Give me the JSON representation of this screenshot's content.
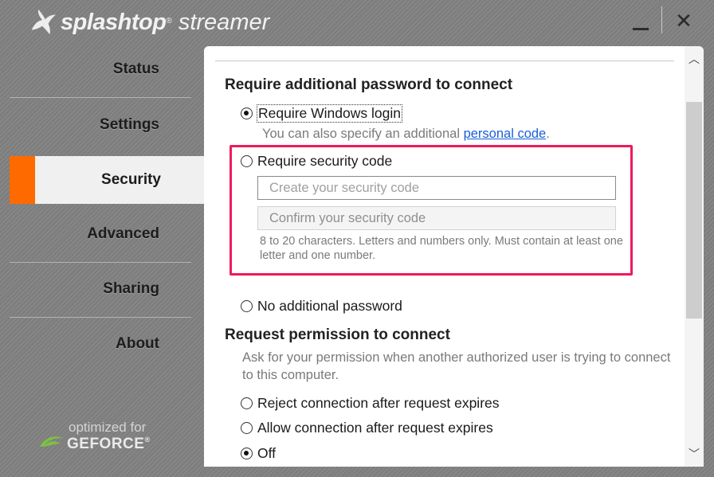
{
  "app": {
    "logo_part1": "splashtop",
    "logo_tm": "®",
    "logo_part2": "streamer",
    "logo_icon": "splashtop-bird-icon",
    "minimize_icon": "minimize-icon",
    "close_icon": "close-icon",
    "close_glyph": "✕"
  },
  "sidebar": {
    "items": [
      {
        "label": "Status"
      },
      {
        "label": "Settings"
      },
      {
        "label": "Security",
        "active": true
      },
      {
        "label": "Advanced"
      },
      {
        "label": "Sharing"
      },
      {
        "label": "About"
      }
    ],
    "accent_color": "#ff6a00",
    "footer_line1": "optimized for",
    "footer_line2": "GEFORCE",
    "footer_reg": "®"
  },
  "security": {
    "password_section_title": "Require additional password to connect",
    "option_windows_login": "Require Windows login",
    "windows_login_hint_prefix": "You can also specify an additional ",
    "windows_login_hint_link": "personal code",
    "windows_login_hint_suffix": ".",
    "option_security_code": "Require security code",
    "create_code_placeholder": "Create your security code",
    "confirm_code_placeholder": "Confirm your security code",
    "code_rules": "8 to 20 characters. Letters and numbers only. Must contain at least one letter and one number.",
    "option_no_password": "No additional password",
    "permission_section_title": "Request permission to connect",
    "permission_description": "Ask for your permission when another authorized user is trying to connect to this computer.",
    "option_reject": "Reject connection after request expires",
    "option_allow": "Allow connection after request expires",
    "option_off": "Off",
    "highlight_color": "#ee1a5c"
  },
  "scrollbar": {
    "up_glyph": "︿",
    "down_glyph": "﹀"
  }
}
